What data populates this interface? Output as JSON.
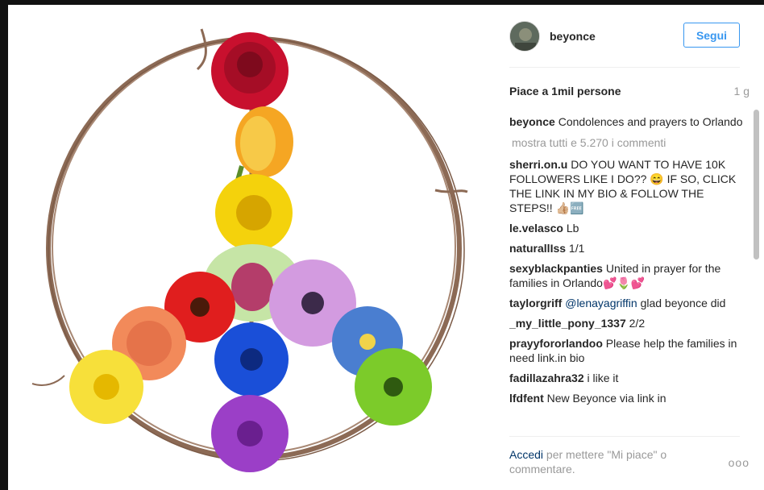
{
  "post": {
    "username": "beyonce",
    "follow_label": "Segui",
    "likes": "Piace a 1mil persone",
    "time": "1 g",
    "show_all": "mostra tutti e 5.270 i commenti",
    "caption": {
      "author": "beyonce",
      "text": "Condolences and prayers to Orlando"
    },
    "comments": [
      {
        "author": "sherri.on.u",
        "text": "DO YOU WANT TO HAVE 10K FOLLOWERS LIKE I DO?? 😄 IF SO, CLICK THE LINK IN MY BIO & FOLLOW THE STEPS!! 👍🏼🆓"
      },
      {
        "author": "le.velasco",
        "text": "Lb"
      },
      {
        "author": "naturallIss",
        "text": "1/1"
      },
      {
        "author": "sexyblackpanties",
        "text": "United in prayer for the families in Orlando💕🌷💕"
      },
      {
        "author": "taylorgriff",
        "mention": "@lenayagriffin",
        "text": "glad beyonce did"
      },
      {
        "author": "_my_little_pony_1337",
        "text": "2/2"
      },
      {
        "author": "prayyfororlandoo",
        "text": "Please help the families in need link.in bio"
      },
      {
        "author": "fadillazahra32",
        "text": "i like it"
      },
      {
        "author": "lfdfent",
        "text": "New Beyonce via link in"
      }
    ],
    "footer": {
      "login": "Accedi",
      "text": "per mettere \"Mi piace\" o commentare."
    },
    "more": "ooo"
  },
  "colors": {
    "accent": "#3897f0",
    "link": "#003569",
    "muted": "#999999"
  },
  "icons": {
    "more": "more-options-icon"
  }
}
